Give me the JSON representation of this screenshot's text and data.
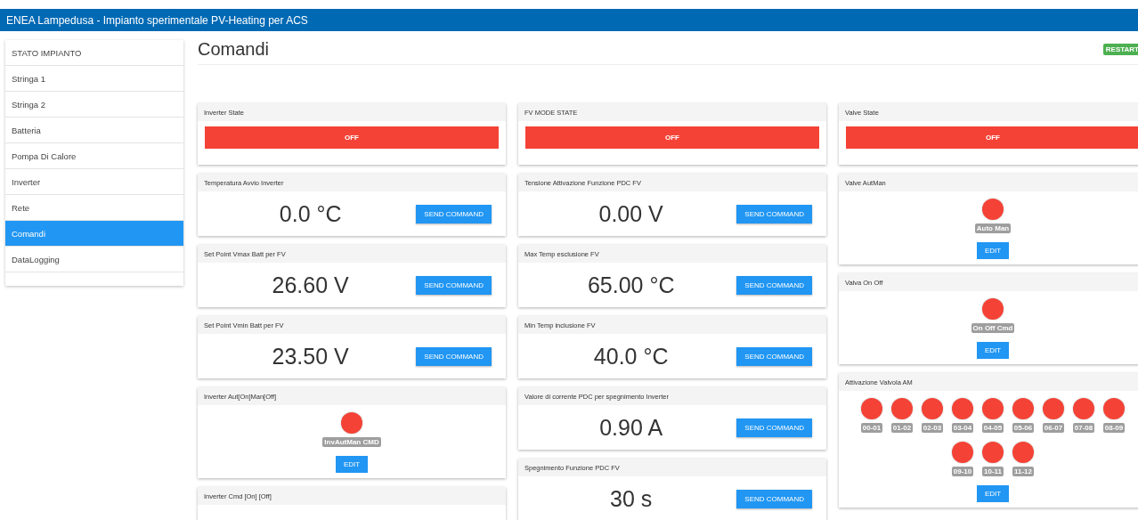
{
  "app_bar": {
    "title": "ENEA Lampedusa - Impianto sperimentale PV-Heating per ACS"
  },
  "sidebar": {
    "items": [
      {
        "label": "STATO IMPIANTO",
        "selected": false
      },
      {
        "label": "Stringa 1",
        "selected": false
      },
      {
        "label": "Stringa 2",
        "selected": false
      },
      {
        "label": "Batteria",
        "selected": false
      },
      {
        "label": "Pompa Di Calore",
        "selected": false
      },
      {
        "label": "Inverter",
        "selected": false
      },
      {
        "label": "Rete",
        "selected": false
      },
      {
        "label": "Comandi",
        "selected": true
      },
      {
        "label": "DataLogging",
        "selected": false
      }
    ]
  },
  "page": {
    "title": "Comandi",
    "restart_button": "RESTART"
  },
  "columns": [
    {
      "cards": [
        {
          "kind": "state",
          "title": "Inverter State",
          "state_label": "OFF",
          "on": false
        },
        {
          "kind": "command",
          "title": "Temperatura Avvio Inverter",
          "value": "0.0 °C",
          "button": "SEND COMMAND"
        },
        {
          "kind": "command",
          "title": "Set Point Vmax Batt per FV",
          "value": "26.60 V",
          "button": "SEND COMMAND"
        },
        {
          "kind": "command",
          "title": "Set Point Vmin Batt per FV",
          "value": "23.50 V",
          "button": "SEND COMMAND"
        },
        {
          "kind": "lamps",
          "title": "Inverter Aut[On]Man[Off]",
          "lamps": [
            {
              "label": "InvAutMan CMD",
              "on": false
            }
          ],
          "button": "EDIT"
        },
        {
          "kind": "header",
          "title": "Inverter Cmd [On] [Off]"
        }
      ]
    },
    {
      "cards": [
        {
          "kind": "state",
          "title": "FV MODE STATE",
          "state_label": "OFF",
          "on": false
        },
        {
          "kind": "command",
          "title": "Tensione Attivazione Funzione PDC FV",
          "value": "0.00 V",
          "button": "SEND COMMAND"
        },
        {
          "kind": "command",
          "title": "Max Temp esclusione FV",
          "value": "65.00 °C",
          "button": "SEND COMMAND"
        },
        {
          "kind": "command",
          "title": "Min Temp inclusione FV",
          "value": "40.0 °C",
          "button": "SEND COMMAND"
        },
        {
          "kind": "command",
          "title": "Valore di corrente PDC per spegnimento Inverter",
          "value": "0.90 A",
          "button": "SEND COMMAND"
        },
        {
          "kind": "command",
          "title": "Spegnimento Funzione PDC FV",
          "value": "30 s",
          "button": "SEND COMMAND"
        }
      ]
    },
    {
      "cards": [
        {
          "kind": "state",
          "title": "Valve State",
          "state_label": "OFF",
          "on": false
        },
        {
          "kind": "lamps",
          "title": "Valve AutMan",
          "lamps": [
            {
              "label": "Auto Man",
              "on": false
            }
          ],
          "button": "EDIT"
        },
        {
          "kind": "lamps",
          "title": "Valva On Off",
          "lamps": [
            {
              "label": "On Off Cmd",
              "on": false
            }
          ],
          "button": "EDIT"
        },
        {
          "kind": "lamps",
          "title": "Attivazione Valvola AM",
          "lamps": [
            {
              "label": "00-01",
              "on": false
            },
            {
              "label": "01-02",
              "on": false
            },
            {
              "label": "02-03",
              "on": false
            },
            {
              "label": "03-04",
              "on": false
            },
            {
              "label": "04-05",
              "on": false
            },
            {
              "label": "05-06",
              "on": false
            },
            {
              "label": "06-07",
              "on": false
            },
            {
              "label": "07-08",
              "on": false
            },
            {
              "label": "08-09",
              "on": false
            },
            {
              "label": "09-10",
              "on": false
            },
            {
              "label": "10-11",
              "on": false
            },
            {
              "label": "11-12",
              "on": false
            }
          ],
          "button": "EDIT"
        }
      ]
    }
  ]
}
